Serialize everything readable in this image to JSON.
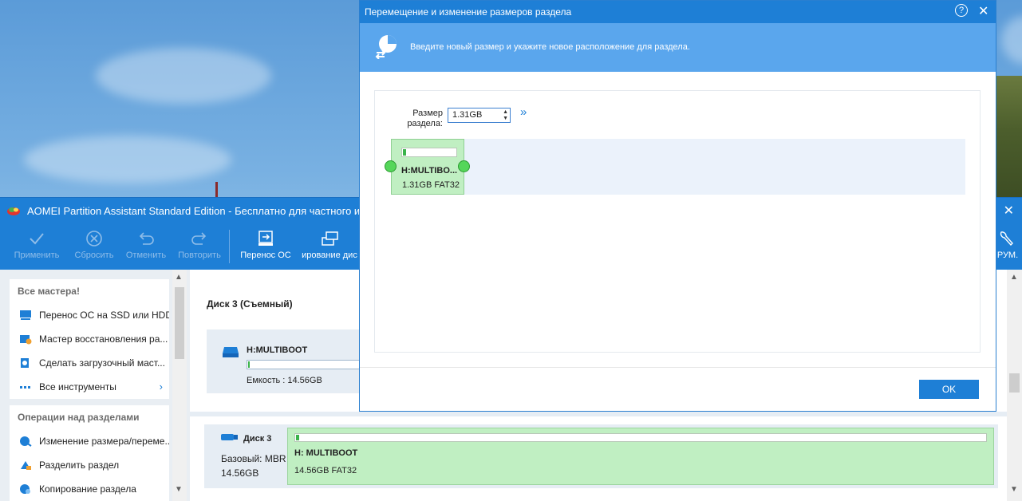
{
  "app": {
    "title": "AOMEI Partition Assistant Standard Edition - Бесплатно для частного и",
    "toolbar": {
      "apply": "Применить",
      "discard": "Сбросить",
      "undo": "Отменить",
      "redo": "Повторить",
      "migrate_os": "Перенос ОС",
      "clone_disk": "ирование дис",
      "tools_right": "РУМ."
    },
    "wizards": {
      "heading": "Все мастера!",
      "items": [
        "Перенос ОС на SSD или HDD",
        "Мастер восстановления ра...",
        "Сделать загрузочный маст...",
        "Все инструменты"
      ]
    },
    "operations": {
      "heading": "Операции над разделами",
      "items": [
        "Изменение размера/переме...",
        "Разделить раздел",
        "Копирование раздела"
      ]
    },
    "disk_card": {
      "title": "Диск 3 (Съемный)",
      "partition_name": "H:MULTIBOOT",
      "capacity": "Емкость : 14.56GB"
    },
    "disk_row": {
      "name": "Диск 3",
      "type": "Базовый: MBR",
      "size": "14.56GB",
      "partition_name": "H: MULTIBOOT",
      "partition_info": "14.56GB FAT32",
      "used_fraction": 0.004
    }
  },
  "dialog": {
    "title": "Перемещение и изменение размеров раздела",
    "help": "?",
    "close": "✕",
    "banner_text": "Введите новый размер и укажите новое расположение для раздела.",
    "size_label": "Размер раздела:",
    "size_value": "1.31GB",
    "more": "»",
    "partition_name": "H:MULTIBO...",
    "partition_info": "1.31GB FAT32",
    "ok": "OK"
  },
  "colors": {
    "accent": "#1e7fd6",
    "banner": "#5aa6ed",
    "partition_fill": "#c0efc2",
    "used_bar": "#3ab34a"
  }
}
